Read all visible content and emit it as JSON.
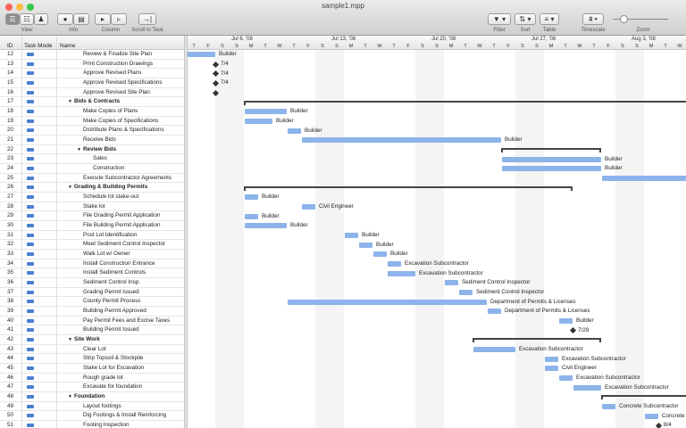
{
  "window": {
    "title": "sample1.mpp",
    "close_color": "#fc605c",
    "min_color": "#fdbc40",
    "max_color": "#34c84a"
  },
  "toolbar": {
    "view_label": "View",
    "info_label": "Info",
    "column_label": "Column",
    "scroll_label": "Scroll to Task",
    "filter_label": "Filter",
    "sort_label": "Sort",
    "table_label": "Table",
    "timescale_label": "Timescale",
    "zoom_label": "Zoom",
    "zoom_level": 0.2
  },
  "columns": {
    "id": "ID",
    "mode": "Task Mode",
    "name": "Name"
  },
  "timescale": {
    "weeks": [
      {
        "label": "Jul 6, '08",
        "day": 3
      },
      {
        "label": "Jul 13, '08",
        "day": 10
      },
      {
        "label": "Jul 20, '08",
        "day": 17
      },
      {
        "label": "Jul 27, '08",
        "day": 24
      },
      {
        "label": "Aug 3, '08",
        "day": 31
      }
    ],
    "days": [
      "T",
      "F",
      "S",
      "S",
      "M",
      "T",
      "W",
      "T",
      "F",
      "S",
      "S",
      "M",
      "T",
      "W",
      "T",
      "F",
      "S",
      "S",
      "M",
      "T",
      "W",
      "T",
      "F",
      "S",
      "S",
      "M",
      "T",
      "W",
      "T",
      "F",
      "S",
      "S",
      "M",
      "T",
      "W"
    ],
    "first_day": "2008-07-03"
  },
  "bar_color": "#8db4ea",
  "tasks": [
    {
      "id": "12",
      "name": "Review & Finalize Site Plan",
      "level": 2,
      "start": 0,
      "days": 2,
      "res": "Builder"
    },
    {
      "id": "13",
      "name": "Print Construction Drawings",
      "level": 2,
      "ms": 2,
      "res": "7/4"
    },
    {
      "id": "14",
      "name": "Approve Revised Plans",
      "level": 2,
      "ms": 2,
      "res": "7/4"
    },
    {
      "id": "15",
      "name": "Approve Revised Specifications",
      "level": 2,
      "ms": 2,
      "res": "7/4"
    },
    {
      "id": "16",
      "name": "Approve Revised Site Plan",
      "level": 2,
      "ms": 2,
      "res": ""
    },
    {
      "id": "17",
      "name": "Bids & Contracts",
      "level": 1,
      "summary": true,
      "start": 4,
      "days": 40
    },
    {
      "id": "18",
      "name": "Make Copies of Plans",
      "level": 2,
      "start": 4,
      "days": 3,
      "res": "Builder"
    },
    {
      "id": "19",
      "name": "Make Copies of Specifications",
      "level": 2,
      "start": 4,
      "days": 2,
      "res": "Builder"
    },
    {
      "id": "20",
      "name": "Distribute Plans & Specifications",
      "level": 2,
      "start": 7,
      "days": 1,
      "res": "Builder"
    },
    {
      "id": "21",
      "name": "Receive Bids",
      "level": 2,
      "start": 8,
      "days": 14,
      "res": "Builder"
    },
    {
      "id": "22",
      "name": "Review Bids",
      "level": 2,
      "summary": true,
      "start": 22,
      "days": 7
    },
    {
      "id": "23",
      "name": "Sales",
      "level": 3,
      "start": 22,
      "days": 7,
      "res": "Builder"
    },
    {
      "id": "24",
      "name": "Construction",
      "level": 3,
      "start": 22,
      "days": 7,
      "res": "Builder"
    },
    {
      "id": "25",
      "name": "Execute Subcontractor Agreements",
      "level": 2,
      "start": 29,
      "days": 10,
      "res": ""
    },
    {
      "id": "26",
      "name": "Grading & Building Permits",
      "level": 1,
      "summary": true,
      "start": 4,
      "days": 23
    },
    {
      "id": "27",
      "name": "Schedule lot stake-out",
      "level": 2,
      "start": 4,
      "days": 1,
      "res": "Builder"
    },
    {
      "id": "28",
      "name": "Stake lot",
      "level": 2,
      "start": 8,
      "days": 1,
      "res": "Civil Engineer"
    },
    {
      "id": "29",
      "name": "File Grading Permit Application",
      "level": 2,
      "start": 4,
      "days": 1,
      "res": "Builder"
    },
    {
      "id": "30",
      "name": "File Building Permit Application",
      "level": 2,
      "start": 4,
      "days": 3,
      "res": "Builder"
    },
    {
      "id": "31",
      "name": "Post Lot Identification",
      "level": 2,
      "start": 11,
      "days": 1,
      "res": "Builder"
    },
    {
      "id": "32",
      "name": "Meet Sediment Control Inspector",
      "level": 2,
      "start": 12,
      "days": 1,
      "res": "Builder"
    },
    {
      "id": "33",
      "name": "Walk Lot w/ Owner",
      "level": 2,
      "start": 13,
      "days": 1,
      "res": "Builder"
    },
    {
      "id": "34",
      "name": "Install Construction Entrance",
      "level": 2,
      "start": 14,
      "days": 1,
      "res": "Excavation Subcontractor"
    },
    {
      "id": "35",
      "name": "Install Sediment Controls",
      "level": 2,
      "start": 14,
      "days": 2,
      "res": "Excavation Subcontractor"
    },
    {
      "id": "36",
      "name": "Sediment Control Insp.",
      "level": 2,
      "start": 18,
      "days": 1,
      "res": "Sediment Control Inspector"
    },
    {
      "id": "37",
      "name": "Grading Permit Issued",
      "level": 2,
      "start": 19,
      "days": 1,
      "res": "Sediment Control Inspector"
    },
    {
      "id": "38",
      "name": "County Permit Process",
      "level": 2,
      "start": 7,
      "days": 14,
      "res": "Department of Permits & Licenses"
    },
    {
      "id": "39",
      "name": "Building Permit Approved",
      "level": 2,
      "start": 21,
      "days": 1,
      "res": "Department of Permits & Licenses"
    },
    {
      "id": "40",
      "name": "Pay Permit Fees and Excise Taxes",
      "level": 2,
      "start": 26,
      "days": 1,
      "res": "Builder"
    },
    {
      "id": "41",
      "name": "Building Permit Issued",
      "level": 2,
      "ms": 27,
      "res": "7/29"
    },
    {
      "id": "42",
      "name": "Site Work",
      "level": 1,
      "summary": true,
      "start": 20,
      "days": 9
    },
    {
      "id": "43",
      "name": "Clear Lot",
      "level": 2,
      "start": 20,
      "days": 3,
      "res": "Excavation Subcontractor"
    },
    {
      "id": "44",
      "name": "Strip Topsoil & Stockpile",
      "level": 2,
      "start": 25,
      "days": 1,
      "res": "Excavation Subcontractor"
    },
    {
      "id": "45",
      "name": "Stake Lot for Excavation",
      "level": 2,
      "start": 25,
      "days": 1,
      "res": "Civil Engineer"
    },
    {
      "id": "46",
      "name": "Rough grade lot",
      "level": 2,
      "start": 26,
      "days": 1,
      "res": "Excavation Subcontractor"
    },
    {
      "id": "47",
      "name": "Excavate for foundation",
      "level": 2,
      "start": 27,
      "days": 2,
      "res": "Excavation Subcontractor"
    },
    {
      "id": "48",
      "name": "Foundation",
      "level": 1,
      "summary": true,
      "start": 29,
      "days": 10
    },
    {
      "id": "49",
      "name": "Layout footings",
      "level": 2,
      "start": 29,
      "days": 1,
      "res": "Concrete Subcontractor"
    },
    {
      "id": "50",
      "name": "Dig Footings & Install Reinforcing",
      "level": 2,
      "start": 32,
      "days": 1,
      "res": "Concrete Subcontractor"
    },
    {
      "id": "51",
      "name": "Footing Inspection",
      "level": 2,
      "ms": 33,
      "res": "8/4"
    }
  ]
}
